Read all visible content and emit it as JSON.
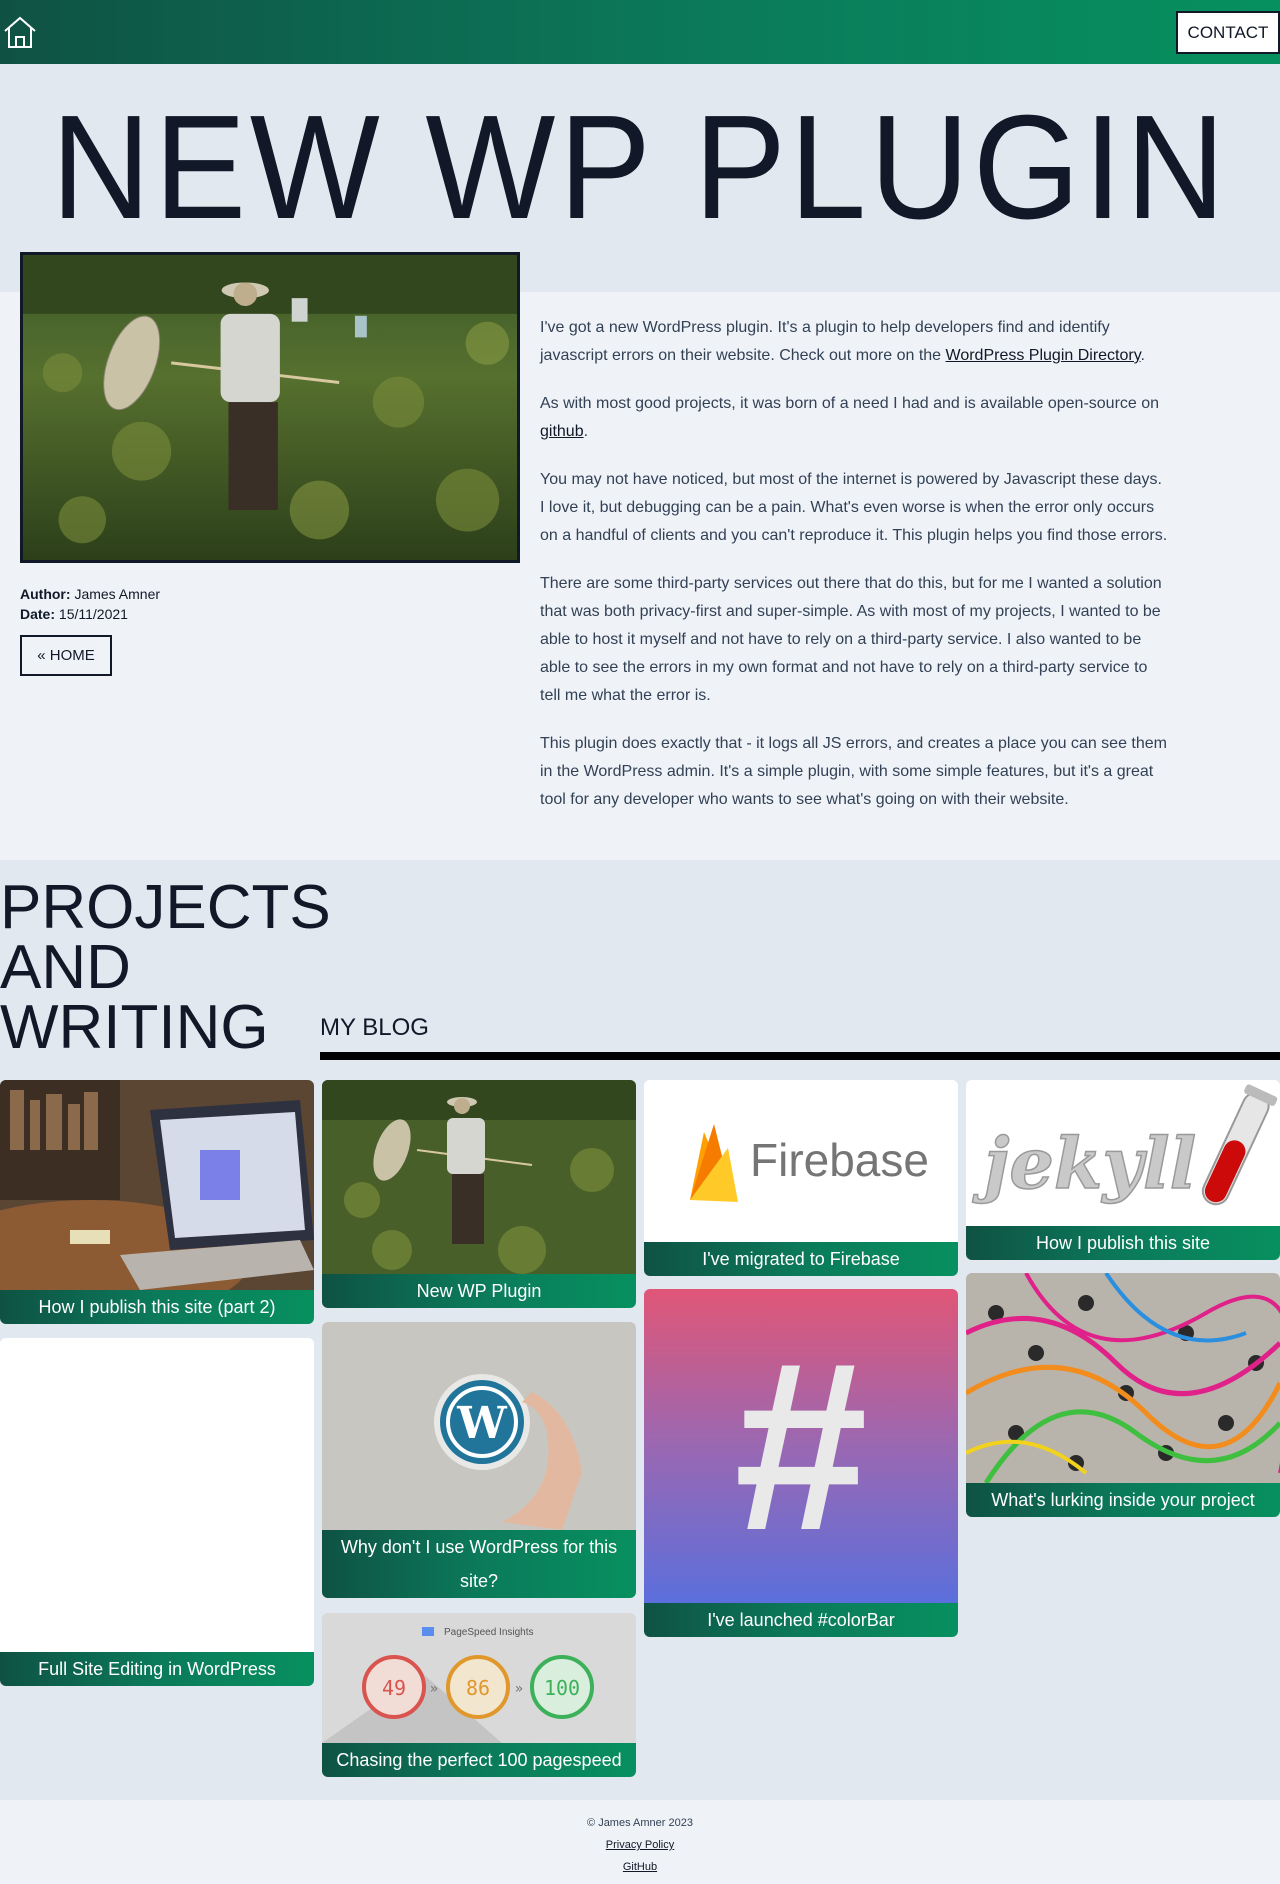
{
  "nav": {
    "contact_label": "CONTACT"
  },
  "hero": {
    "title": "NEW WP PLUGIN"
  },
  "meta": {
    "author_label": "Author:",
    "author": "James Amner",
    "date_label": "Date:",
    "date": "15/11/2021",
    "home_label": "« HOME"
  },
  "content": {
    "p1_a": "I've got a new WordPress plugin. It's a plugin to help developers find and identify javascript errors on their website. Check out more on the ",
    "p1_link": "WordPress Plugin Directory",
    "p1_b": ".",
    "p2_a": "As with most good projects, it was born of a need I had and is available open-source on ",
    "p2_link": "github",
    "p2_b": ".",
    "p3": "You may not have noticed, but most of the internet is powered by Javascript these days. I love it, but debugging can be a pain. What's even worse is when the error only occurs on a handful of clients and you can't reproduce it. This plugin helps you find those errors.",
    "p4": "There are some third-party services out there that do this, but for me I wanted a solution that was both privacy-first and super-simple. As with most of my projects, I wanted to be able to host it myself and not have to rely on a third-party service. I also wanted to be able to see the errors in my own format and not have to rely on a third-party service to tell me what the error is.",
    "p5": "This plugin does exactly that - it logs all JS errors, and creates a place you can see them in the WordPress admin. It's a simple plugin, with some simple features, but it's a great tool for any developer who wants to see what's going on with their website."
  },
  "projects": {
    "title_1": "PROJECTS",
    "title_2": "AND",
    "title_3": "WRITING",
    "blog_title": "MY BLOG"
  },
  "cards": {
    "c1": "How I publish this site (part 2)",
    "c2": "Full Site Editing in WordPress",
    "c3": "New WP Plugin",
    "c4": "Why don't I use WordPress for this site?",
    "c5": "Chasing the perfect 100 pagespeed",
    "c6": "I've migrated to Firebase",
    "c7": "I've launched #colorBar",
    "c8": "How I publish this site",
    "c9": "What's lurking inside your project"
  },
  "logos": {
    "firebase": "Firebase",
    "jekyll": "jekyll",
    "hash": "#",
    "pagespeed": "PageSpeed Insights",
    "score1": "49",
    "score2": "86",
    "score3": "100",
    "arrow": "»"
  },
  "footer": {
    "copyright": "© James Amner 2023",
    "privacy": "Privacy Policy",
    "github": "GitHub"
  },
  "colors": {
    "accent": "#0b7a5a",
    "dark": "#111827",
    "page": "#e2e8f0",
    "panel": "#eff3f8"
  },
  "icons": {
    "home": "home-icon"
  }
}
